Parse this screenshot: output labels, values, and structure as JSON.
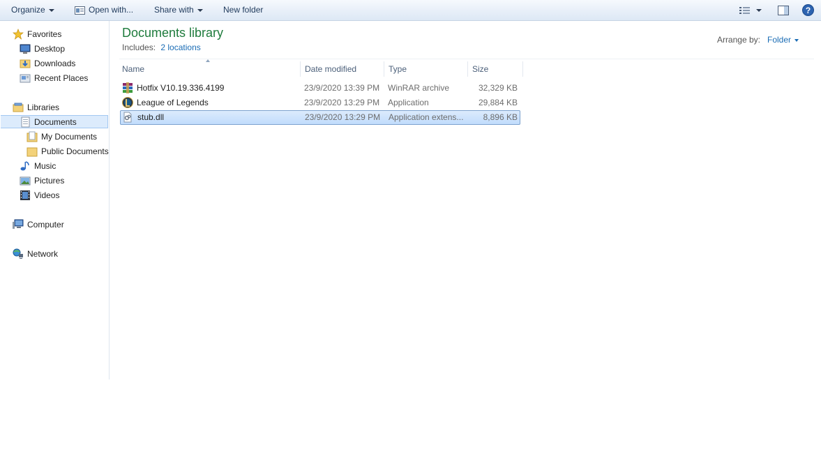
{
  "toolbar": {
    "organize": "Organize",
    "open_with": "Open with...",
    "share_with": "Share with",
    "new_folder": "New folder"
  },
  "nav": {
    "favorites": "Favorites",
    "desktop": "Desktop",
    "downloads": "Downloads",
    "recent_places": "Recent Places",
    "libraries": "Libraries",
    "documents": "Documents",
    "my_documents": "My Documents",
    "public_documents": "Public Documents",
    "music": "Music",
    "pictures": "Pictures",
    "videos": "Videos",
    "computer": "Computer",
    "network": "Network"
  },
  "library": {
    "title": "Documents library",
    "includes_label": "Includes:",
    "locations_link": "2 locations",
    "arrange_label": "Arrange by:",
    "arrange_value": "Folder"
  },
  "columns": {
    "name": "Name",
    "date": "Date modified",
    "type": "Type",
    "size": "Size"
  },
  "files": [
    {
      "name": "Hotfix V10.19.336.4199",
      "date": "23/9/2020 13:39 PM",
      "type": "WinRAR archive",
      "size": "32,329 KB",
      "icon": "winrar-archive-icon",
      "selected": false
    },
    {
      "name": "League of Legends",
      "date": "23/9/2020 13:29 PM",
      "type": "Application",
      "size": "29,884 KB",
      "icon": "league-of-legends-icon",
      "selected": false
    },
    {
      "name": "stub.dll",
      "date": "23/9/2020 13:29 PM",
      "type": "Application extens...",
      "size": "8,896 KB",
      "icon": "dll-file-icon",
      "selected": true
    }
  ],
  "colors": {
    "title_green": "#1e7b3c",
    "link_blue": "#1a6cb5",
    "selection_bg": "#cce4fc",
    "selection_border": "#7da2ce"
  }
}
